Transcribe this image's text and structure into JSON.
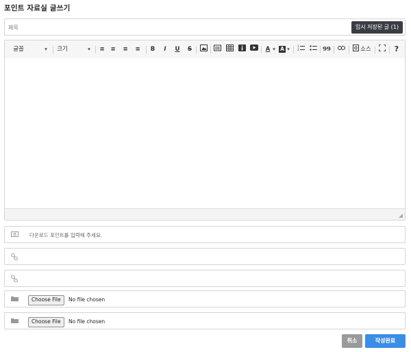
{
  "page": {
    "title": "포인트 자료실 글쓰기"
  },
  "subject": {
    "placeholder": "제목",
    "draft_button": "임시 저장된 글 (1)"
  },
  "toolbar": {
    "font_label": "글꼴",
    "size_label": "크기",
    "dropdown_arrow": "▾",
    "align_left": "≡",
    "align_center": "≡",
    "align_right": "≡",
    "align_justify": "≡",
    "bold": "B",
    "italic": "I",
    "underline": "U",
    "strike": "S",
    "text_color": "A",
    "bg_color": "A",
    "quote": "99",
    "source_label": "소스",
    "help": "?"
  },
  "point_field": {
    "placeholder": "다운로드 포인트를 입력해 주세요."
  },
  "link_fields": [
    {
      "value": ""
    },
    {
      "value": ""
    }
  ],
  "file_fields": [
    {
      "button": "Choose File",
      "status": "No file chosen"
    },
    {
      "button": "Choose File",
      "status": "No file chosen"
    }
  ],
  "actions": {
    "cancel": "취소",
    "submit": "작성완료"
  },
  "colors": {
    "draft_bg": "#3a3d44",
    "cancel_bg": "#9a9a9a",
    "submit_bg": "#3a8ee6"
  }
}
